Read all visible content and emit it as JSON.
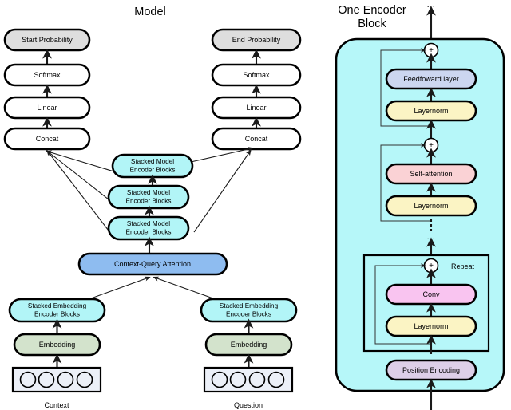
{
  "figure": {
    "left_panel_title": "Model",
    "right_panel_title_line1": "One Encoder",
    "right_panel_title_line2": "Block"
  },
  "colors": {
    "gray_fill": "#dedede",
    "white_fill": "#ffffff",
    "cyan_fill": "#b2f5f7",
    "blue_fill": "#8ebcf0",
    "green_fill": "#d3e3cc",
    "token_box_fill": "#dde3f2",
    "panel_fill": "#b6f7f9",
    "layernorm_fill": "#fbf4c4",
    "selfattention_fill": "#fad2d5",
    "conv_fill": "#f9c4f0",
    "feedforward_fill": "#ccd6f0",
    "position_encoding_fill": "#ddcfe8",
    "stroke": "#000000"
  },
  "model": {
    "left_stack": [
      {
        "label": "Start Probability",
        "fill_key": "gray_fill"
      },
      {
        "label": "Softmax",
        "fill_key": "white_fill"
      },
      {
        "label": "Linear",
        "fill_key": "white_fill"
      },
      {
        "label": "Concat",
        "fill_key": "white_fill"
      }
    ],
    "right_stack": [
      {
        "label": "End Probability",
        "fill_key": "gray_fill"
      },
      {
        "label": "Softmax",
        "fill_key": "white_fill"
      },
      {
        "label": "Linear",
        "fill_key": "white_fill"
      },
      {
        "label": "Concat",
        "fill_key": "white_fill"
      }
    ],
    "model_encoder_blocks": [
      {
        "line1": "Stacked Model",
        "line2": "Encoder Blocks"
      },
      {
        "line1": "Stacked Model",
        "line2": "Encoder Blocks"
      },
      {
        "line1": "Stacked Model",
        "line2": "Encoder Blocks"
      }
    ],
    "attention": {
      "label": "Context-Query Attention"
    },
    "context_branch": {
      "encoder_line1": "Stacked Embedding",
      "encoder_line2": "Encoder Blocks",
      "embedding_label": "Embedding",
      "caption": "Context",
      "token_count": 4
    },
    "question_branch": {
      "encoder_line1": "Stacked Embedding",
      "encoder_line2": "Encoder Blocks",
      "embedding_label": "Embedding",
      "caption": "Question",
      "token_count": 4
    }
  },
  "encoder_block": {
    "top_ellipsis": "...",
    "middle_ellipsis": "...",
    "repeat_label": "Repeat",
    "plus_symbol": "+",
    "layers": [
      {
        "label": "Feedfoward layer",
        "fill_key": "feedforward_fill"
      },
      {
        "label": "Layernorm",
        "fill_key": "layernorm_fill"
      },
      {
        "label": "Self-attention",
        "fill_key": "selfattention_fill"
      },
      {
        "label": "Layernorm",
        "fill_key": "layernorm_fill"
      },
      {
        "label": "Conv",
        "fill_key": "conv_fill"
      },
      {
        "label": "Layernorm",
        "fill_key": "layernorm_fill"
      },
      {
        "label": "Position Encoding",
        "fill_key": "position_encoding_fill"
      }
    ]
  }
}
